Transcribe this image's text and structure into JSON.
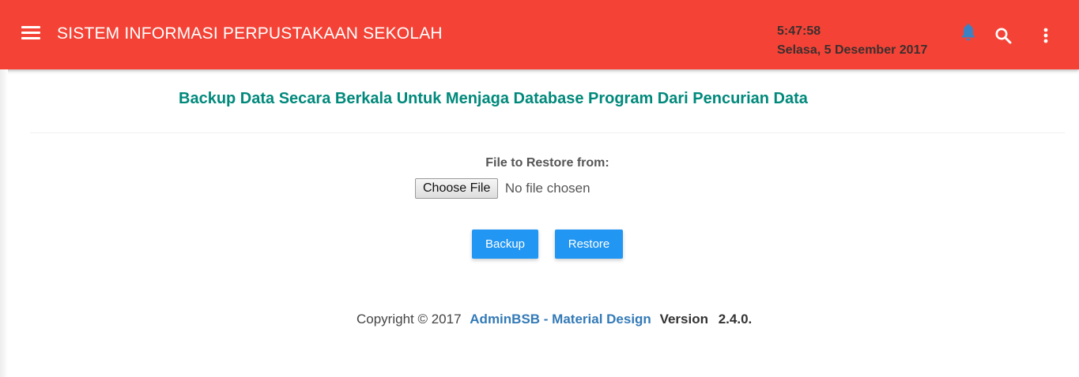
{
  "header": {
    "title": "SISTEM INFORMASI PERPUSTAKAAN SEKOLAH",
    "time": "5:47:58",
    "date": "Selasa, 5 Desember 2017",
    "icons": [
      "menu-icon",
      "bell-icon",
      "search-icon",
      "more-vert-icon"
    ],
    "bar_color": "#F44336"
  },
  "main": {
    "heading": "Backup Data Secara Berkala Untuk Menjaga Database Program Dari Pencurian Data",
    "restore_label": "File to Restore from:",
    "choose_file_label": "Choose File",
    "no_file_text": "No file chosen",
    "backup_label": "Backup",
    "restore_button_label": "Restore",
    "heading_color": "#00897B",
    "button_color": "#2196F3"
  },
  "footer": {
    "copyright": "Copyright © 2017",
    "brand": "AdminBSB - Material Design",
    "version_label": "Version",
    "version": "2.4.0."
  }
}
